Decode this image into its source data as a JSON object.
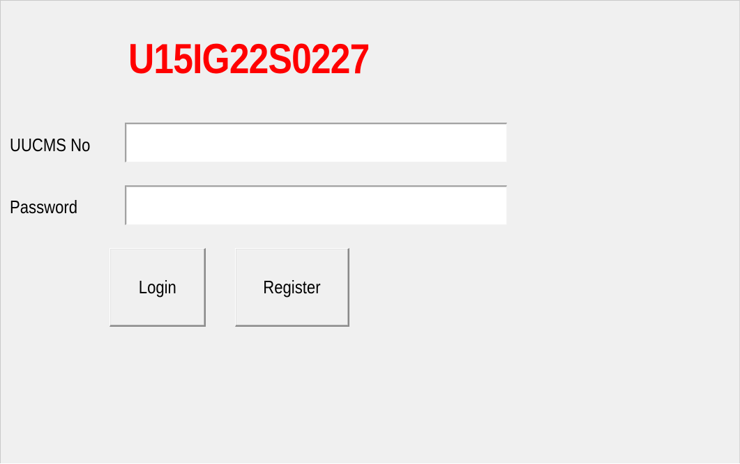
{
  "form": {
    "title": "U15IG22S0227",
    "uucms": {
      "label": "UUCMS No",
      "value": ""
    },
    "password": {
      "label": "Password",
      "value": ""
    },
    "buttons": {
      "login": "Login",
      "register": "Register"
    }
  },
  "colors": {
    "title": "#ff0000",
    "window_background": "#f0f0f0"
  }
}
